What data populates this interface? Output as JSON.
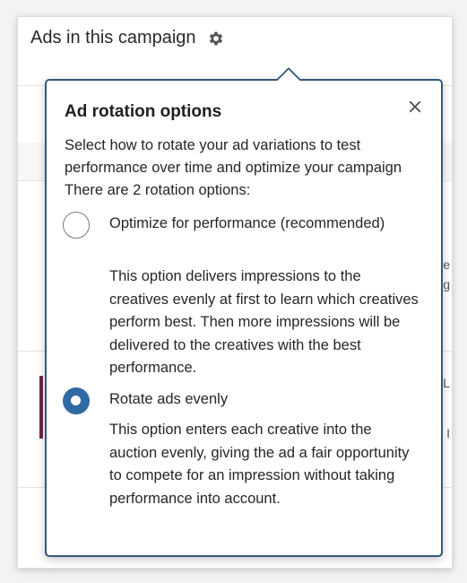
{
  "background": {
    "header_title": "Ads in this campaign",
    "header_icon": "gear-icon",
    "fragments": [
      "e",
      "g",
      "L",
      "I"
    ]
  },
  "popover": {
    "title": "Ad rotation options",
    "close_icon": "close-icon",
    "close_symbol": "✕",
    "intro": "Select how to rotate your ad variations to test performance over time and optimize your campaign There are 2 rotation options:",
    "options": [
      {
        "label": "Optimize for performance (recommended)",
        "description": "This option delivers impressions to the creatives evenly at first to learn which creatives perform best. Then more impressions will be delivered to the creatives with the best performance.",
        "selected": false
      },
      {
        "label": "Rotate ads evenly",
        "description": "This option enters each creative into the auction evenly, giving the ad a fair opportunity to compete for an impression without taking performance into account.",
        "selected": true
      }
    ]
  },
  "colors": {
    "popover_border": "#34597a",
    "radio_selected": "#2f6aa3",
    "accent_bar": "#6b2a45"
  }
}
